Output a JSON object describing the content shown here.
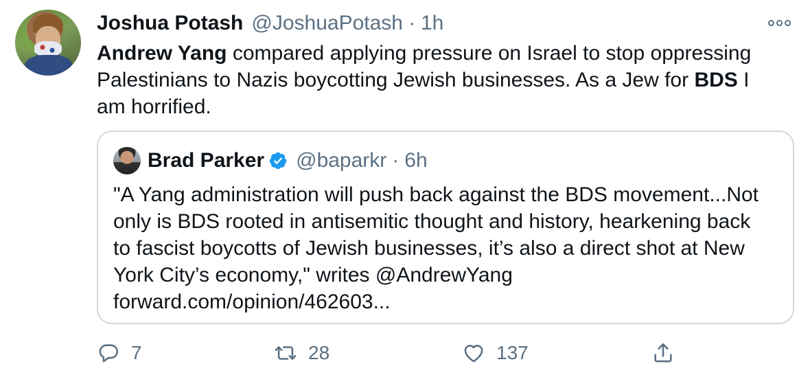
{
  "tweet": {
    "author": {
      "name": "Joshua Potash",
      "handle": "@JoshuaPotash",
      "separator": "·",
      "time": "1h"
    },
    "text": {
      "segments": [
        {
          "text": "Andrew Yang",
          "bold": true
        },
        {
          "text": " compared applying pressure on Israel to stop oppressing",
          "bold": false
        },
        {
          "text": "Palestinians to Nazis boycotting Jewish businesses. As a Jew for ",
          "bold": false
        },
        {
          "text": "BDS",
          "bold": true
        },
        {
          "text": " I",
          "bold": false
        },
        {
          "text": "am horrified.",
          "bold": false
        }
      ]
    },
    "more_icon": "more-horizontal-icon"
  },
  "quote": {
    "author": {
      "name": "Brad Parker",
      "verified_icon": "verified-badge-icon",
      "handle": "@baparkr",
      "separator": "·",
      "time": "6h"
    },
    "lines": [
      "\"A Yang administration will push back against the BDS movement...Not",
      "only is BDS rooted in antisemitic thought and history, hearkening back",
      "to fascist boycotts of Jewish businesses, it’s also a direct shot at New",
      "York City’s economy,\" writes @AndrewYang",
      "forward.com/opinion/462603..."
    ]
  },
  "actions": {
    "reply": {
      "icon": "reply-icon",
      "count": "7"
    },
    "retweet": {
      "icon": "retweet-icon",
      "count": "28"
    },
    "like": {
      "icon": "heart-icon",
      "count": "137"
    },
    "share": {
      "icon": "share-icon"
    }
  },
  "colors": {
    "text": "#0f1419",
    "muted": "#5b7083",
    "border": "#cfd9de",
    "verified": "#1d9bf0"
  }
}
